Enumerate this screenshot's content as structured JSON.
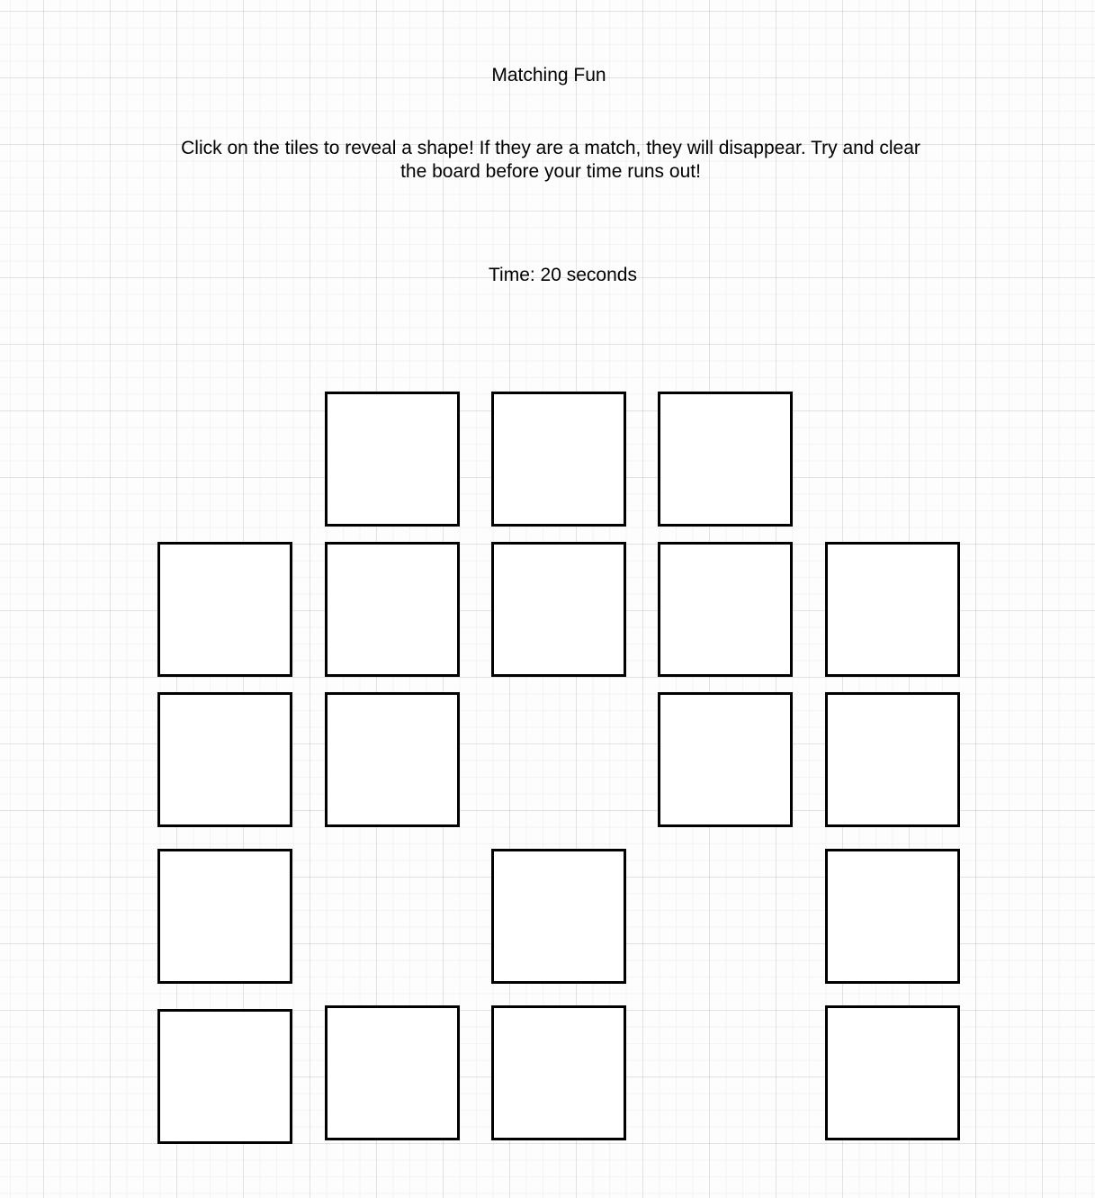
{
  "game": {
    "title": "Matching Fun",
    "instructions": "Click on the tiles to reveal a shape!  If they are a match, they will disappear. Try and clear the board before your time runs out!",
    "timer": {
      "text": "Time: 20 seconds",
      "seconds_remaining": 20
    }
  },
  "board": {
    "columns": 5,
    "rows": 5,
    "tile_state": "face-down",
    "tile_fill": "#ffffff",
    "tile_border": "#000000",
    "remaining_tiles": 19,
    "grid": [
      [
        false,
        true,
        true,
        true,
        false
      ],
      [
        true,
        true,
        true,
        true,
        true
      ],
      [
        true,
        true,
        false,
        true,
        true
      ],
      [
        true,
        false,
        true,
        false,
        true
      ],
      [
        true,
        true,
        true,
        false,
        true
      ]
    ]
  }
}
